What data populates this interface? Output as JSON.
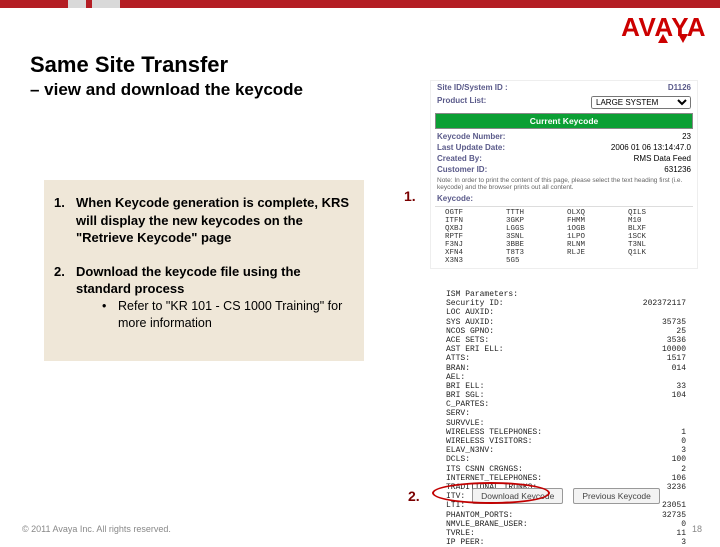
{
  "brand": "AVAYA",
  "title": "Same Site Transfer",
  "subtitle": "– view and download the keycode",
  "steps": {
    "one": {
      "num": "1.",
      "text": "When Keycode generation is complete, KRS will display the new keycodes on the \"Retrieve Keycode\" page"
    },
    "two": {
      "num": "2.",
      "text": "Download the keycode file using the standard process"
    },
    "bullet": "Refer to \"KR 101 - CS 1000 Training\" for more information"
  },
  "callouts": {
    "one": "1.",
    "two": "2."
  },
  "shot": {
    "site_label": "Site ID/System ID :",
    "site_value": "D1126",
    "product_label": "Product List:",
    "product_value": "LARGE SYSTEM",
    "greenbar": "Current Keycode",
    "kc_num_label": "Keycode Number:",
    "kc_num_value": "23",
    "lu_label": "Last Update Date:",
    "lu_value": "2006 01 06 13:14:47.0",
    "cb_label": "Created By:",
    "cb_value": "RMS Data Feed",
    "cust_label": "Customer ID:",
    "cust_value": "631236",
    "note": "Note: In order to print the content of this page, please select the text heading first (i.e. keycode) and the browser prints out all content.",
    "subhdr": "Keycode:",
    "grid": {
      "r": [
        [
          "OGTF",
          "TTTH",
          "OLXQ",
          "QILS"
        ],
        [
          "ITFN",
          "3GKP",
          "FHMM",
          "M10"
        ],
        [
          "QXBJ",
          "LGGS",
          "1OGB",
          "BLXF"
        ],
        [
          "RPTF",
          "3SNL",
          "1LPO",
          "1SCK"
        ],
        [
          "F3NJ",
          "3BBE",
          "RLNM",
          "T3NL"
        ],
        [
          "XFN4",
          "T8T3",
          "RLJE",
          "Q1LK"
        ],
        [
          "X3N3",
          "5G5"
        ]
      ]
    }
  },
  "mono": [
    [
      "ISM Parameters:",
      ""
    ],
    [
      "Security ID:",
      "202372117"
    ],
    [
      "LOC AUXID:",
      ""
    ],
    [
      "SYS AUXID:",
      "35735"
    ],
    [
      "NCOS GPNO:",
      "25"
    ],
    [
      "ACE SETS:",
      "3536"
    ],
    [
      "AST ERI ELL:",
      "10000"
    ],
    [
      "ATTS:",
      "1517"
    ],
    [
      "BRAN:",
      "014"
    ],
    [
      "AEL:",
      ""
    ],
    [
      "BRI ELL:",
      "33"
    ],
    [
      "BRI SGL:",
      "104"
    ],
    [
      "C_PARTES:",
      ""
    ],
    [
      "SERV:",
      ""
    ],
    [
      "SURVVLE:",
      ""
    ],
    [
      "WIRELESS TELEPHONES:",
      "1"
    ],
    [
      "WIRELESS VISITORS:",
      "0"
    ],
    [
      "ELAV_N3NV:",
      "3"
    ],
    [
      "DCLS:",
      "100"
    ],
    [
      "ITS CSNN CRGNGS:",
      "2"
    ],
    [
      "INTERNET_TELEPHONES:",
      "106"
    ],
    [
      "TRADITIONAL_TRUNKS:",
      "3236"
    ],
    [
      "ITV:",
      ""
    ],
    [
      "LTI:",
      "23051"
    ],
    [
      "PHANTOM_PORTS:",
      "32735"
    ],
    [
      "NMVLE_BRANE_USER:",
      "0"
    ],
    [
      "TVRLE:",
      "11"
    ],
    [
      "IP PEER:",
      "3"
    ]
  ],
  "buttons": {
    "download": "Download Keycode",
    "previous": "Previous Keycode"
  },
  "footer": {
    "copyright": "© 2011 Avaya Inc. All rights reserved.",
    "page": "18"
  }
}
